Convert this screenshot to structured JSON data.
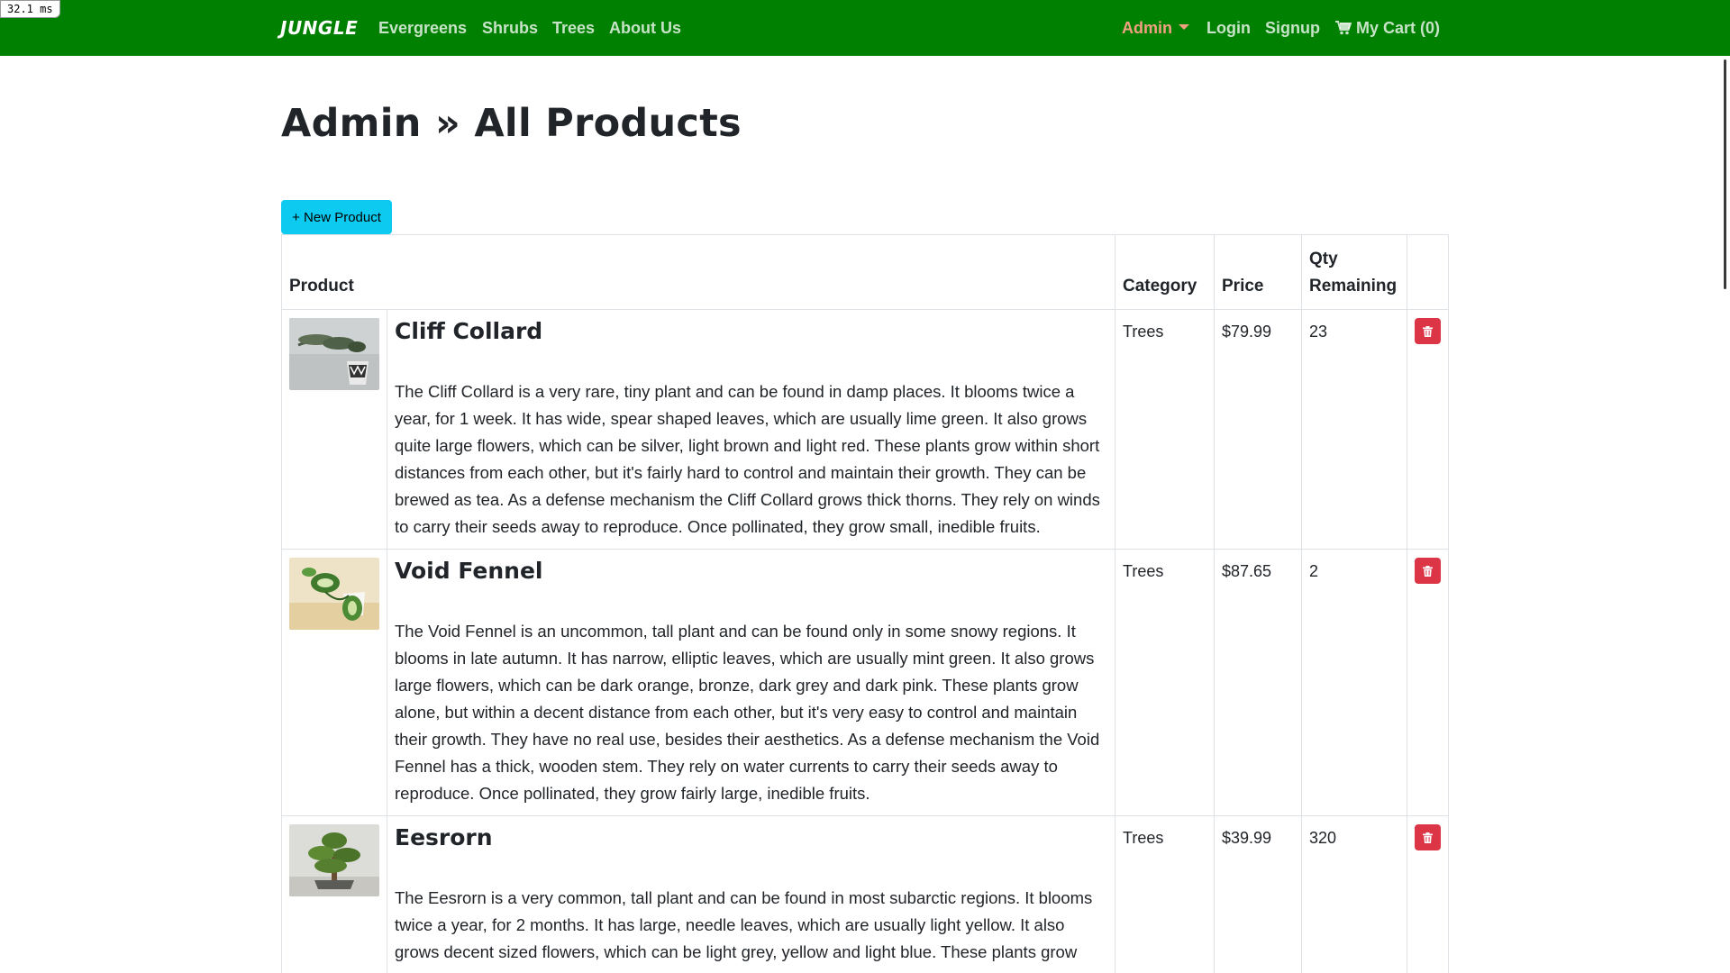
{
  "timer": "32.1 ms",
  "nav": {
    "brand": "JUNGLE",
    "links": [
      "Evergreens",
      "Shrubs",
      "Trees",
      "About Us"
    ],
    "admin": "Admin",
    "login": "Login",
    "signup": "Signup",
    "cart": "My Cart (0)"
  },
  "page": {
    "title": "Admin » All Products",
    "new_product": "+ New Product"
  },
  "table": {
    "headers": {
      "product": "Product",
      "category": "Category",
      "price": "Price",
      "qty_line1": "Qty",
      "qty_line2": "Remaining"
    },
    "rows": [
      {
        "name": "Cliff Collard",
        "description": "The Cliff Collard is a very rare, tiny plant and can be found in damp places. It blooms twice a year, for 1 week. It has wide, spear shaped leaves, which are usually lime green. It also grows quite large flowers, which can be silver, light brown and light red. These plants grow within short distances from each other, but it's fairly hard to control and maintain their growth. They can be brewed as tea. As a defense mechanism the Cliff Collard grows thick thorns. They rely on winds to carry their seeds away to reproduce. Once pollinated, they grow small, inedible fruits.",
        "category": "Trees",
        "price": "$79.99",
        "qty": "23"
      },
      {
        "name": "Void Fennel",
        "description": "The Void Fennel is an uncommon, tall plant and can be found only in some snowy regions. It blooms in late autumn. It has narrow, elliptic leaves, which are usually mint green. It also grows large flowers, which can be dark orange, bronze, dark grey and dark pink. These plants grow alone, but within a decent distance from each other, but it's very easy to control and maintain their growth. They have no real use, besides their aesthetics. As a defense mechanism the Void Fennel has a thick, wooden stem. They rely on water currents to carry their seeds away to reproduce. Once pollinated, they grow fairly large, inedible fruits.",
        "category": "Trees",
        "price": "$87.65",
        "qty": "2"
      },
      {
        "name": "Eesrorn",
        "description": "The Eesrorn is a very common, tall plant and can be found in most subarctic regions. It blooms twice a year, for 2 months. It has large, needle leaves, which are usually light yellow. It also grows decent sized flowers, which can be light grey, yellow and light blue. These plants grow",
        "category": "Trees",
        "price": "$39.99",
        "qty": "320"
      }
    ]
  }
}
